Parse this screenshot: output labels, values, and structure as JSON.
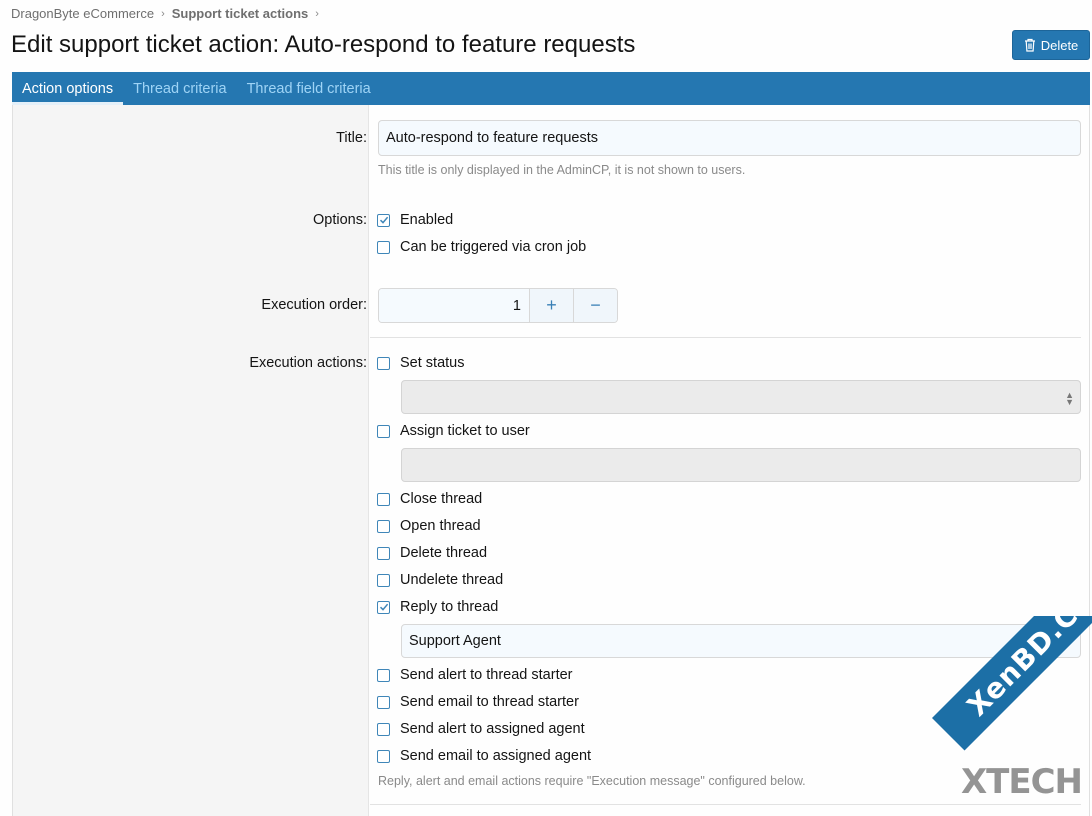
{
  "breadcrumb": {
    "item1": "DragonByte eCommerce",
    "item2": "Support ticket actions"
  },
  "page_title": "Edit support ticket action: Auto-respond to feature requests",
  "delete_label": "Delete",
  "tabs": [
    "Action options",
    "Thread criteria",
    "Thread field criteria"
  ],
  "fields": {
    "title_label": "Title:",
    "title_value": "Auto-respond to feature requests",
    "title_hint": "This title is only displayed in the AdminCP, it is not shown to users.",
    "options_label": "Options:",
    "options": [
      {
        "label": "Enabled",
        "checked": true
      },
      {
        "label": "Can be triggered via cron job",
        "checked": false
      }
    ],
    "execution_order_label": "Execution order:",
    "execution_order_value": "1",
    "plus_glyph": "+",
    "minus_glyph": "−",
    "execution_actions_label": "Execution actions:",
    "actions": [
      {
        "label": "Set status",
        "checked": false
      },
      {
        "label": "Assign ticket to user",
        "checked": false
      },
      {
        "label": "Close thread",
        "checked": false
      },
      {
        "label": "Open thread",
        "checked": false
      },
      {
        "label": "Delete thread",
        "checked": false
      },
      {
        "label": "Undelete thread",
        "checked": false
      },
      {
        "label": "Reply to thread",
        "checked": true
      },
      {
        "label": "Send alert to thread starter",
        "checked": false
      },
      {
        "label": "Send email to thread starter",
        "checked": false
      },
      {
        "label": "Send alert to assigned agent",
        "checked": false
      },
      {
        "label": "Send email to assigned agent",
        "checked": false
      }
    ],
    "reply_user_value": "Support Agent",
    "actions_hint": "Reply, alert and email actions require \"Execution message\" configured below."
  },
  "watermark": {
    "band": "XenBD.Com",
    "text": "XTECH"
  },
  "colors": {
    "accent": "#2577b1",
    "tab_inactive": "#9fd4f6",
    "label_bg": "#f5f5f5"
  }
}
